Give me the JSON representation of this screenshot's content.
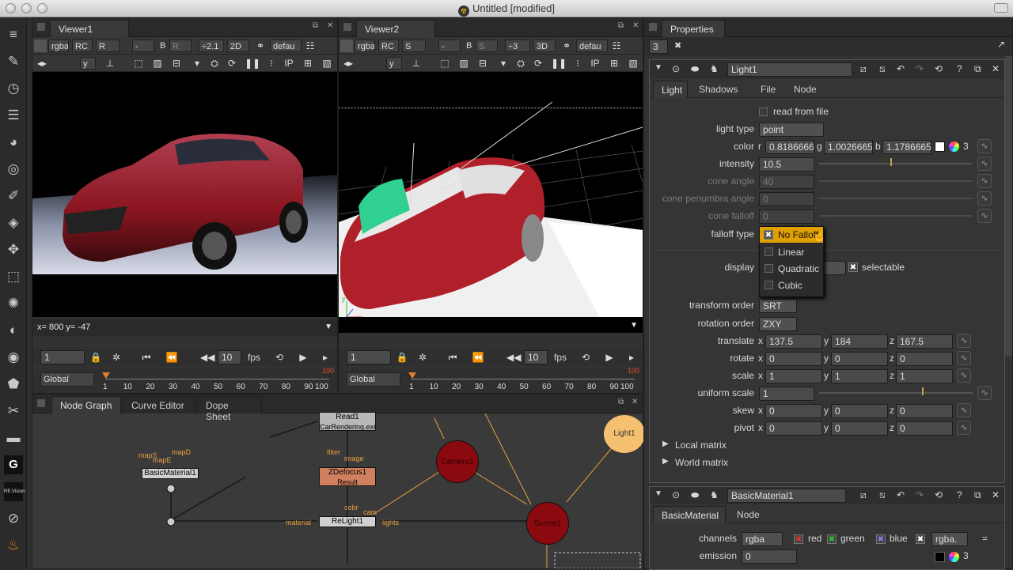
{
  "window": {
    "title": "Untitled [modified]"
  },
  "viewer1": {
    "tab": "Viewer1",
    "channels": "rgba",
    "channel_a": "RC",
    "channel_b": "R",
    "dash": "-",
    "b_label": "B",
    "b_val": "R",
    "zoom": "÷2.1",
    "view_mode": "2D",
    "lut": "defau",
    "y_label": "y",
    "readout": "x= 800 y= -47",
    "frame": "1",
    "fps_val": "10",
    "fps_label": "fps",
    "scope": "Global",
    "ticks": [
      "1",
      "10",
      "20",
      "30",
      "40",
      "50",
      "60",
      "70",
      "80",
      "90",
      "100"
    ],
    "end_marker": "100"
  },
  "viewer2": {
    "tab": "Viewer2",
    "channels": "rgba",
    "channel_a": "RC",
    "channel_b": "S",
    "dash": "-",
    "b_label": "B",
    "b_val": "S",
    "zoom": "÷3",
    "view_mode": "3D",
    "lut": "defau",
    "y_label": "y",
    "frame": "1",
    "fps_val": "10",
    "fps_label": "fps",
    "scope": "Global",
    "ticks": [
      "1",
      "10",
      "20",
      "30",
      "40",
      "50",
      "60",
      "70",
      "80",
      "90",
      "100"
    ],
    "end_marker": "100"
  },
  "nodegraph": {
    "tabs": [
      "Node Graph",
      "Curve Editor",
      "Dope Sheet"
    ],
    "nodes": {
      "read": "Read1",
      "read_sub": "CarRendering.exr",
      "material": "BasicMaterial1",
      "defocus": "ZDefocus1",
      "defocus_sub": "Result",
      "relight": "ReLight1",
      "camera": "Camera1",
      "scene": "Scene1",
      "light": "Light1"
    },
    "pipes": {
      "mapS": "mapS",
      "mapE": "mapE",
      "mapD": "mapD",
      "filter": "filter",
      "image": "image",
      "color": "cobr",
      "cam": "cam",
      "material": "material",
      "lights": "lights"
    }
  },
  "properties": {
    "title": "Properties",
    "max_panels": "3",
    "light_node": {
      "name": "Light1",
      "tabs": [
        "Light",
        "Shadows",
        "File",
        "Node"
      ],
      "read_from_file": "read from file",
      "light_type_label": "light type",
      "light_type": "point",
      "color_label": "color",
      "color_r_label": "r",
      "color_r": "0.8186666",
      "color_g_label": "g",
      "color_g": "1.0026665",
      "color_b_label": "b",
      "color_b": "1.1786665",
      "color_count": "3",
      "intensity_label": "intensity",
      "intensity": "10.5",
      "cone_angle_label": "cone angle",
      "cone_angle": "40",
      "cone_penumbra_label": "cone penumbra angle",
      "cone_penumbra": "0",
      "cone_falloff_label": "cone falloff",
      "cone_falloff": "0",
      "falloff_type_label": "falloff type",
      "falloff_options": [
        "No Falloff",
        "Linear",
        "Quadratic",
        "Cubic"
      ],
      "display_label": "display",
      "selectable": "selectable",
      "transform_order_label": "transform order",
      "transform_order": "SRT",
      "rotation_order_label": "rotation order",
      "rotation_order": "ZXY",
      "translate_label": "translate",
      "translate": {
        "x": "137.5",
        "y": "184",
        "z": "167.5"
      },
      "rotate_label": "rotate",
      "rotate": {
        "x": "0",
        "y": "0",
        "z": "0"
      },
      "scale_label": "scale",
      "scale": {
        "x": "1",
        "y": "1",
        "z": "1"
      },
      "uniform_scale_label": "uniform scale",
      "uniform_scale": "1",
      "skew_label": "skew",
      "skew": {
        "x": "0",
        "y": "0",
        "z": "0"
      },
      "pivot_label": "pivot",
      "pivot": {
        "x": "0",
        "y": "0",
        "z": "0"
      },
      "local_matrix": "Local matrix",
      "world_matrix": "World matrix",
      "axis_x": "x",
      "axis_y": "y",
      "axis_z": "z"
    },
    "material_node": {
      "name": "BasicMaterial1",
      "tabs": [
        "BasicMaterial",
        "Node"
      ],
      "channels_label": "channels",
      "channels": "rgba",
      "red": "red",
      "green": "green",
      "blue": "blue",
      "rgba_short": "rgba.",
      "emission_label": "emission",
      "emission": "0",
      "emission_count": "3"
    }
  }
}
